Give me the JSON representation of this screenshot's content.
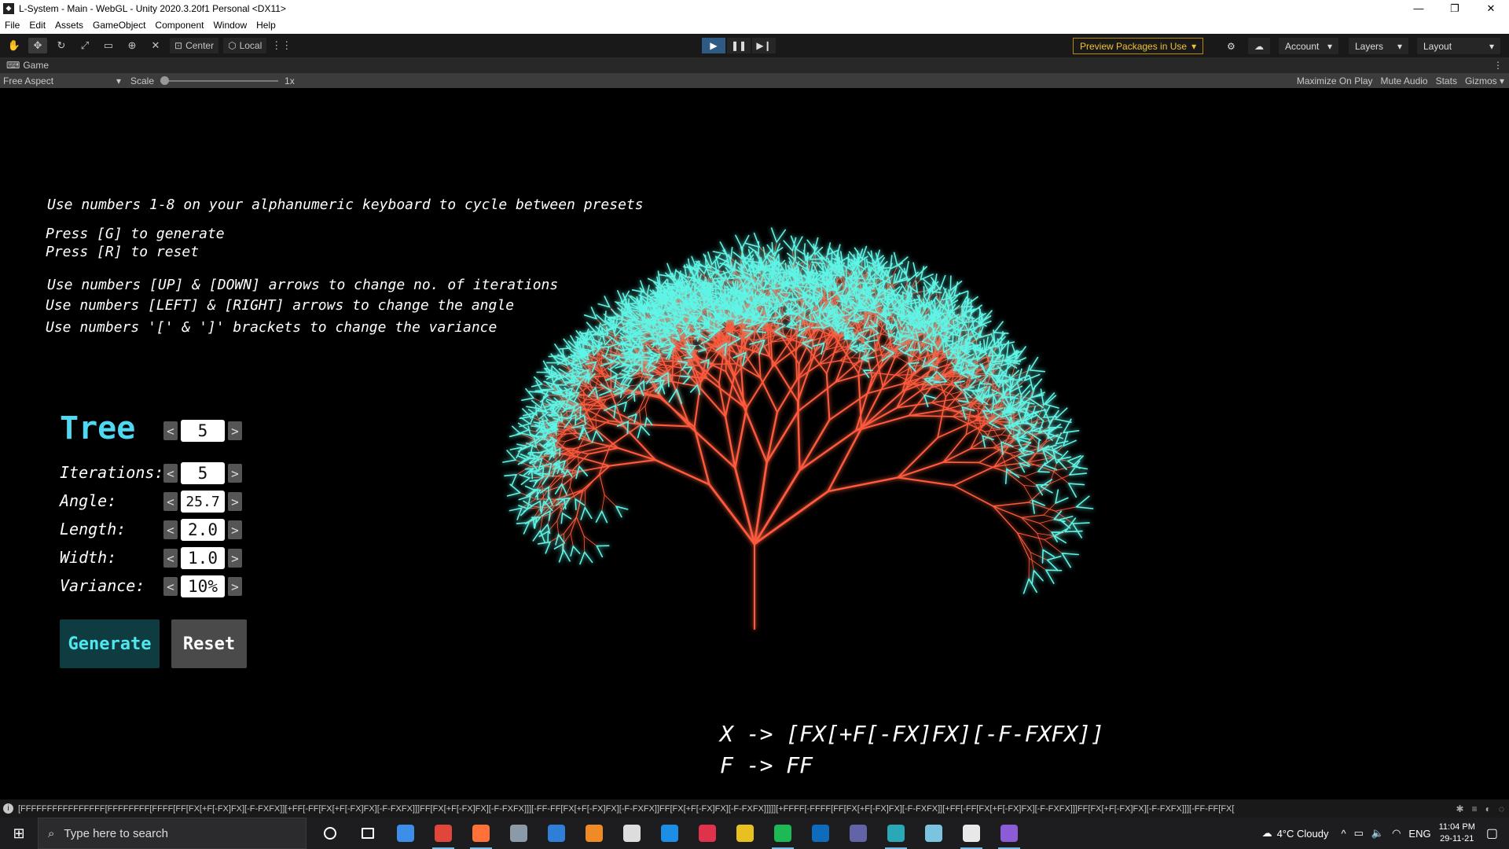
{
  "window": {
    "title": "L-System - Main - WebGL - Unity 2020.3.20f1 Personal <DX11>",
    "buttons": [
      "—",
      "❐",
      "✕"
    ]
  },
  "menu": [
    "File",
    "Edit",
    "Assets",
    "GameObject",
    "Component",
    "Window",
    "Help"
  ],
  "toolbar": {
    "pivot_center": "Center",
    "pivot_local": "Local",
    "preview_packages": "Preview Packages in Use",
    "account": "Account",
    "layers": "Layers",
    "layout": "Layout"
  },
  "game_tab": {
    "label": "Game"
  },
  "game_bar": {
    "aspect": "Free Aspect",
    "scale_label": "Scale",
    "scale_value": "1x",
    "scale_level": 0.0,
    "maximize": "Maximize On Play",
    "mute": "Mute Audio",
    "stats": "Stats",
    "gizmos": "Gizmos"
  },
  "instructions": {
    "presets": "Use numbers 1-8 on your alphanumeric keyboard to cycle between presets",
    "generate": "Press [G] to generate",
    "reset": "Press [R] to reset",
    "iterations": "Use numbers [UP] & [DOWN] arrows to change no. of iterations",
    "angle": "Use numbers [LEFT] & [RIGHT] arrows to change the angle",
    "variance": "Use numbers '[' & ']' brackets to change the variance"
  },
  "panel": {
    "preset_name": "Tree",
    "preset_number": "5",
    "iterations_label": "Iterations:",
    "iterations_value": "5",
    "angle_label": "Angle:",
    "angle_value": "25.7",
    "length_label": "Length:",
    "length_value": "2.0",
    "width_label": "Width:",
    "width_value": "1.0",
    "variance_label": "Variance:",
    "variance_value": "10%",
    "left_arrow": "<",
    "right_arrow": ">",
    "generate_label": "Generate",
    "reset_label": "Reset"
  },
  "rules": {
    "x_rule": "X -> [FX[+F[-FX]FX][-F-FXFX]]",
    "f_rule": "F -> FF"
  },
  "status": {
    "message": "[FFFFFFFFFFFFFFFF[FFFFFFFF[FFFF[FF[FX[+F[-FX]FX][-F-FXFX]][+FF[-FF[FX[+F[-FX]FX][-F-FXFX]]]FF[FX[+F[-FX]FX][-F-FXFX]]][-FF-FF[FX[+F[-FX]FX][-F-FXFX]]FF[FX[+F[-FX]FX][-F-FXFX]]]]][+FFFF[-FFFF[FF[FX[+F[-FX]FX][-F-FXFX]][+FF[-FF[FX[+F[-FX]FX][-F-FXFX]]]FF[FX[+F[-FX]FX][-F-FXFX]]][-FF-FF[FX["
  },
  "taskbar": {
    "search_placeholder": "Type here to search",
    "weather": "4°C  Cloudy",
    "language": "ENG",
    "time": "11:04 PM",
    "date": "29-11-21",
    "apps": [
      {
        "name": "cortana-icon",
        "color": "#1d1d1f"
      },
      {
        "name": "task-view-icon",
        "color": "#1d1d1f"
      },
      {
        "name": "file-explorer-icon",
        "color": "#3d8ee8"
      },
      {
        "name": "chrome-icon",
        "color": "#e0463a"
      },
      {
        "name": "firefox-icon",
        "color": "#ff7139"
      },
      {
        "name": "files-icon",
        "color": "#8a9aa8"
      },
      {
        "name": "mail-icon",
        "color": "#2f7fd8"
      },
      {
        "name": "blender-icon",
        "color": "#f08a24"
      },
      {
        "name": "unreal-icon",
        "color": "#dddddd"
      },
      {
        "name": "blue-app-icon",
        "color": "#1c8ee6"
      },
      {
        "name": "red-app-icon",
        "color": "#e0324a"
      },
      {
        "name": "notes-icon",
        "color": "#e8c020"
      },
      {
        "name": "spotify-icon",
        "color": "#1db954"
      },
      {
        "name": "outlook-icon",
        "color": "#0f6cbd"
      },
      {
        "name": "teams-icon",
        "color": "#6264a7"
      },
      {
        "name": "edge-icon",
        "color": "#2aa8b8"
      },
      {
        "name": "notepad-icon",
        "color": "#7bc4e0"
      },
      {
        "name": "unity-icon",
        "color": "#e8e8e8"
      },
      {
        "name": "visual-studio-icon",
        "color": "#8b5cd6"
      }
    ]
  },
  "colors": {
    "branch": "#ff5a3c",
    "leaf": "#5ff5e6",
    "title_accent": "#4fd8f2",
    "generate_bg": "#0e3c40",
    "generate_fg": "#4fe8f0",
    "reset_bg": "#4a4a4a"
  }
}
